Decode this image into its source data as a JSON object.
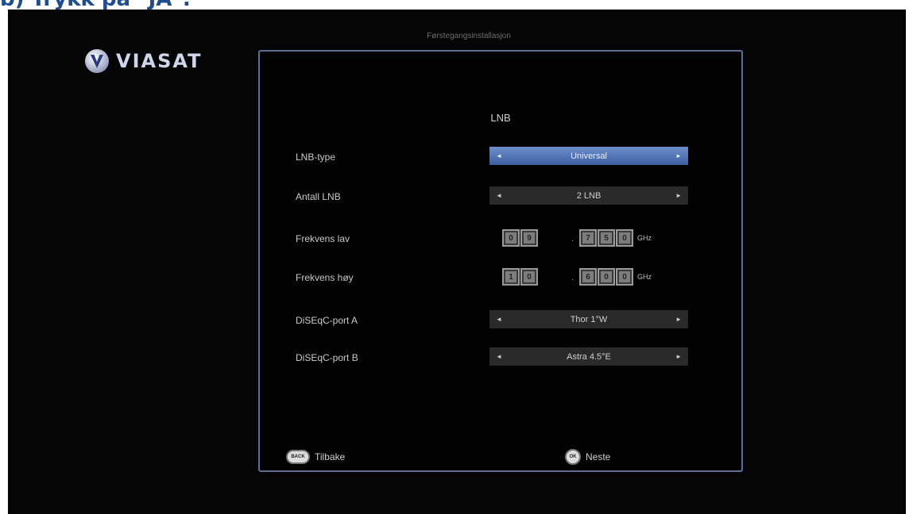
{
  "heading": "b) Trykk på \"JA\".",
  "brand": {
    "name": "VIASAT",
    "icon": "viasat-logo-icon"
  },
  "screen": {
    "title": "Førstegangsinstallasjon"
  },
  "panel": {
    "title": "LNB",
    "rows": {
      "lnb_type": {
        "label": "LNB-type",
        "value": "Universal",
        "active": true
      },
      "antall_lnb": {
        "label": "Antall LNB",
        "value": "2 LNB"
      },
      "frekvens_lav": {
        "label": "Frekvens lav",
        "digits_a": [
          "0",
          "9"
        ],
        "separator": ".",
        "digits_b": [
          "7",
          "5",
          "0"
        ],
        "unit": "GHz"
      },
      "frekvens_hoy": {
        "label": "Frekvens høy",
        "digits_a": [
          "1",
          "0"
        ],
        "separator": ".",
        "digits_b": [
          "6",
          "0",
          "0"
        ],
        "unit": "GHz"
      },
      "diseqc_a": {
        "label": "DiSEqC-port A",
        "value": "Thor 1°W"
      },
      "diseqc_b": {
        "label": "DiSEqC-port B",
        "value": "Astra 4.5°E"
      }
    },
    "arrows": {
      "left": "◄",
      "right": "►"
    }
  },
  "footer": {
    "back": {
      "key": "BACK",
      "label": "Tilbake"
    },
    "next": {
      "key": "OK",
      "label": "Neste"
    }
  },
  "colors": {
    "heading": "#1f4e8f",
    "panel_border": "#5c6f95",
    "active_selector": "#4d72b6",
    "background": "#050505"
  }
}
